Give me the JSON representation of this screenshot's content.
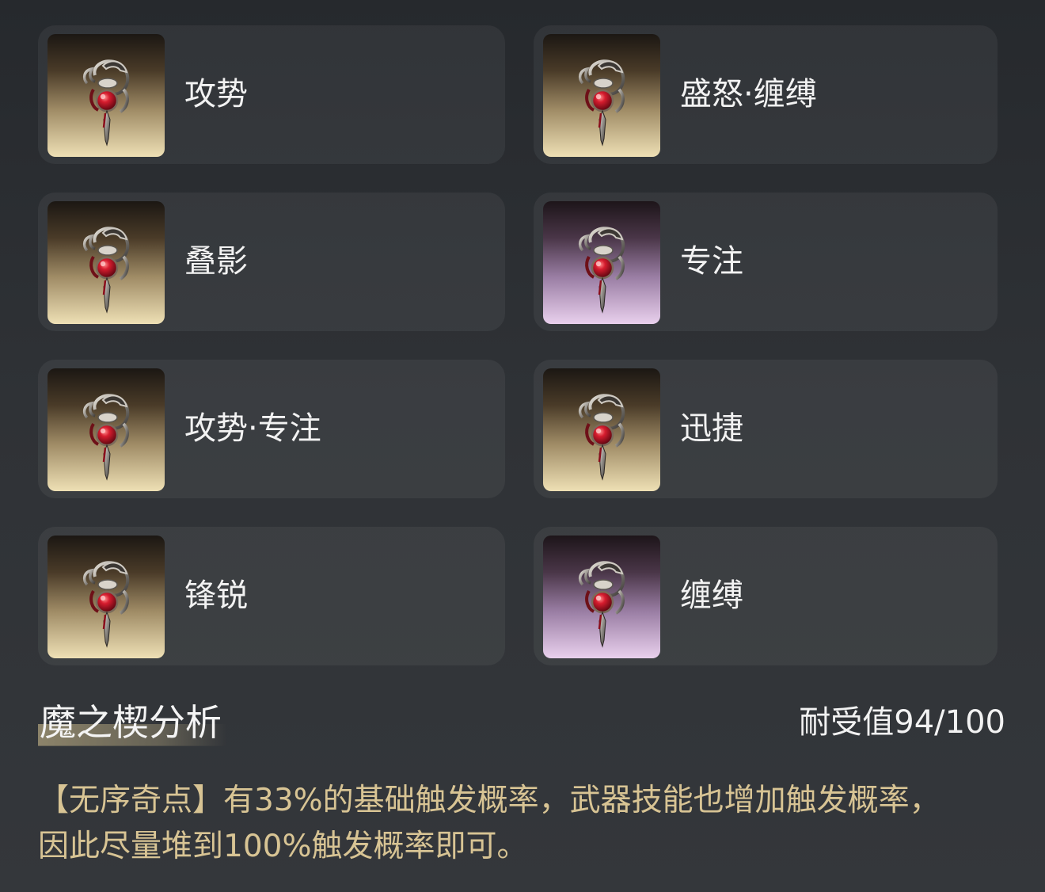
{
  "items": [
    {
      "name": "攻势",
      "rarity": "gold"
    },
    {
      "name": "盛怒·缠缚",
      "rarity": "gold"
    },
    {
      "name": "叠影",
      "rarity": "gold"
    },
    {
      "name": "专注",
      "rarity": "purple"
    },
    {
      "name": "攻势·专注",
      "rarity": "gold"
    },
    {
      "name": "迅捷",
      "rarity": "gold"
    },
    {
      "name": "锋锐",
      "rarity": "gold"
    },
    {
      "name": "缠缚",
      "rarity": "purple"
    }
  ],
  "analysis": {
    "title": "魔之楔分析",
    "durability": "耐受值94/100",
    "text": "【无序奇点】有33%的基础触发概率，武器技能也增加触发概率，因此尽量堆到100%触发概率即可。"
  },
  "colors": {
    "gold_rarity": "#eee0b5",
    "purple_rarity": "#e9d0ed",
    "analysis_text": "#d8c494",
    "gem_red": "#c8142a"
  },
  "icon": "demon-wedge-amulet-icon"
}
